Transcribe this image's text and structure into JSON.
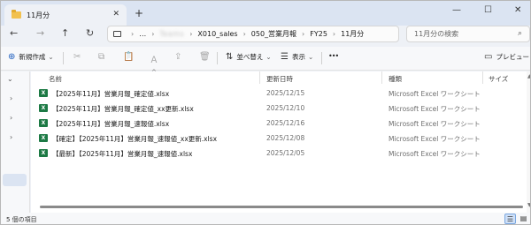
{
  "window": {
    "tab_title": "11月分",
    "tab_close": "✕",
    "new_tab": "+",
    "minimize": "—",
    "maximize": "☐",
    "close": "✕"
  },
  "nav": {
    "back": "←",
    "forward": "→",
    "up": "↑",
    "refresh": "↻",
    "more": "…",
    "breadcrumbs": [
      "X010_sales",
      "050_営業月報",
      "FY25",
      "11月分"
    ],
    "blurred_segment": "Teams",
    "search_placeholder": "11月分の検索",
    "search_icon": "⌕"
  },
  "toolbar": {
    "new_label": "新規作成",
    "new_icon": "⊕",
    "cut_icon": "✂",
    "copy_icon": "⧉",
    "paste_icon": "📋",
    "rename_icon": "Ａ",
    "share_icon": "⇪",
    "delete_icon": "🗑",
    "sort_label": "並べ替え",
    "sort_icon": "⇅",
    "view_label": "表示",
    "view_icon": "☰",
    "more_icon": "•••",
    "preview_label": "プレビュー",
    "preview_icon": "▭"
  },
  "columns": {
    "name": "名前",
    "date": "更新日時",
    "type": "種類",
    "size": "サイズ",
    "sort_arrow": "^"
  },
  "files": [
    {
      "name": "【2025年11月】営業月報_確定値.xlsx",
      "date": "2025/12/15",
      "type": "Microsoft Excel ワークシート"
    },
    {
      "name": "【2025年11月】営業月報_確定値_xx更新.xlsx",
      "date": "2025/12/10",
      "type": "Microsoft Excel ワークシート"
    },
    {
      "name": "【2025年11月】営業月報_速報値.xlsx",
      "date": "2025/12/16",
      "type": "Microsoft Excel ワークシート"
    },
    {
      "name": "【確定】【2025年11月】営業月報_速報値_xx更新.xlsx",
      "date": "2025/12/08",
      "type": "Microsoft Excel ワークシート"
    },
    {
      "name": "【最新】【2025年11月】営業月報_速報値.xlsx",
      "date": "2025/12/05",
      "type": "Microsoft Excel ワークシート"
    }
  ],
  "status": {
    "count": "5 個の項目"
  },
  "colors": {
    "excel_green": "#1d7a45",
    "folder_yellow": "#f2c14e",
    "accent_blue": "#1f5fbf"
  }
}
